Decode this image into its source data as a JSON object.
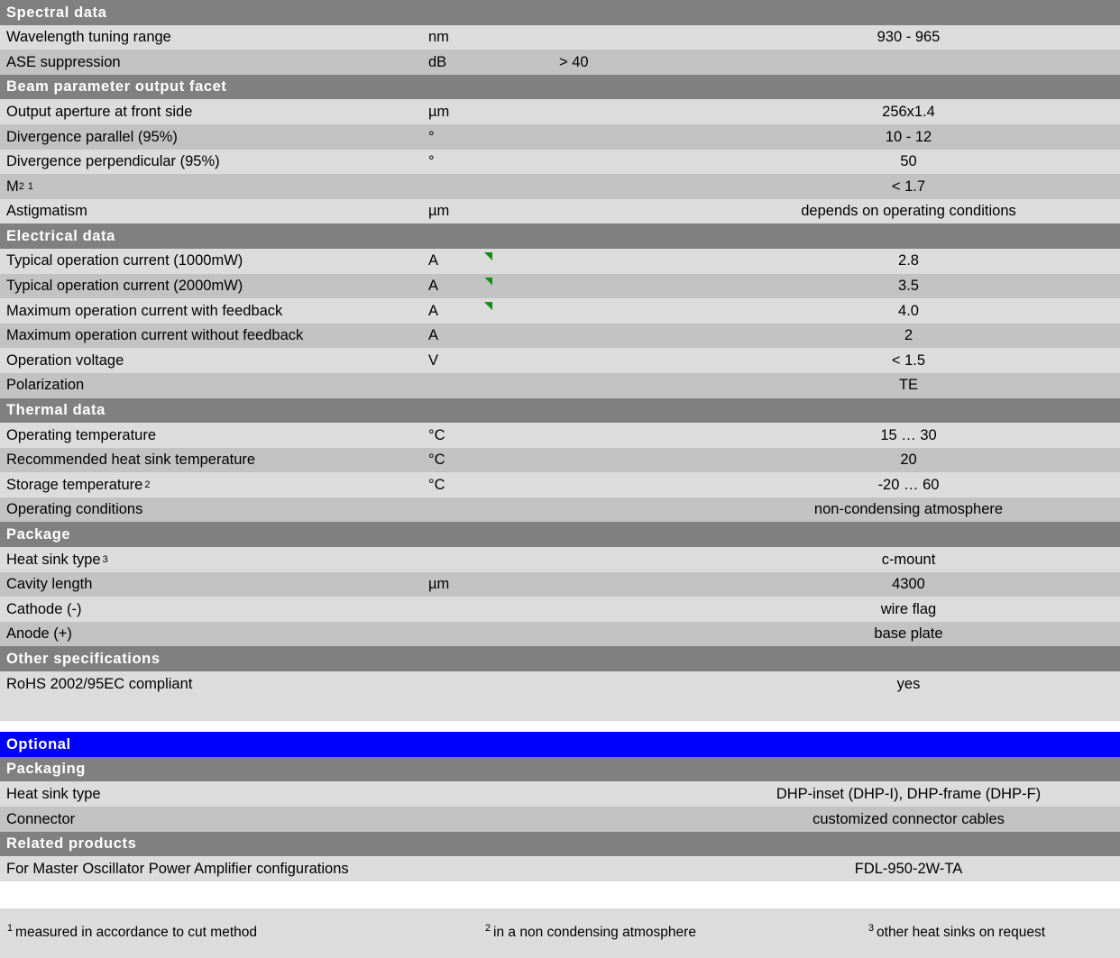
{
  "colors": {
    "section_header_bg": "#808080",
    "row_light_bg": "#dcdcdc",
    "row_dark_bg": "#c2c2c2",
    "optional_accent_bg": "#0000ff",
    "note_marker": "#128c12",
    "text": "#000000",
    "header_text": "#ffffff"
  },
  "sections": [
    {
      "title": "Spectral data",
      "rows": [
        {
          "label": "Wavelength tuning range",
          "unit": "nm",
          "extra": "",
          "value": "930 - 965",
          "marker": false
        },
        {
          "label": "ASE suppression",
          "unit": "dB",
          "extra": "> 40",
          "value": "",
          "marker": false
        }
      ]
    },
    {
      "title": "Beam parameter output facet",
      "rows": [
        {
          "label": "Output aperture at front side",
          "unit": "µm",
          "extra": "",
          "value": "256x1.4",
          "marker": false
        },
        {
          "label": "Divergence parallel (95%)",
          "unit": "°",
          "extra": "",
          "value": "10 - 12",
          "marker": false
        },
        {
          "label": "Divergence perpendicular (95%)",
          "unit": "°",
          "extra": "",
          "value": "50",
          "marker": false
        },
        {
          "label": "M2 1",
          "label_html": "M<sup class=\"exp\">2</sup><sup class=\"note\">1</sup>",
          "unit": "",
          "extra": "",
          "value": "< 1.7",
          "marker": false
        },
        {
          "label": "Astigmatism",
          "unit": "µm",
          "extra": "",
          "value": "depends on operating conditions",
          "marker": false
        }
      ]
    },
    {
      "title": "Electrical data",
      "rows": [
        {
          "label": "Typical operation current (1000mW)",
          "unit": "A",
          "extra": "",
          "value": "2.8",
          "marker": true
        },
        {
          "label": "Typical operation current (2000mW)",
          "unit": "A",
          "extra": "",
          "value": "3.5",
          "marker": true
        },
        {
          "label": "Maximum operation current with feedback",
          "unit": "A",
          "extra": "",
          "value": "4.0",
          "marker": true
        },
        {
          "label": "Maximum operation current without feedback",
          "unit": "A",
          "extra": "",
          "value": "2",
          "marker": false
        },
        {
          "label": "Operation voltage",
          "unit": "V",
          "extra": "",
          "value": "< 1.5",
          "marker": false
        },
        {
          "label": "Polarization",
          "unit": "",
          "extra": "",
          "value": "TE",
          "marker": false
        }
      ]
    },
    {
      "title": "Thermal data",
      "rows": [
        {
          "label": "Operating temperature",
          "unit": "°C",
          "extra": "",
          "value": "15 … 30",
          "marker": false
        },
        {
          "label": "Recommended heat sink temperature",
          "unit": "°C",
          "extra": "",
          "value": "20",
          "marker": false
        },
        {
          "label": "Storage temperature 2",
          "label_html": "Storage temperature <sup>2</sup>",
          "unit": "°C",
          "extra": "",
          "value": "-20 … 60",
          "marker": false
        },
        {
          "label": "Operating conditions",
          "unit": "",
          "extra": "",
          "value": "non-condensing atmosphere",
          "marker": false
        }
      ]
    },
    {
      "title": "Package",
      "rows": [
        {
          "label": "Heat sink type 3",
          "label_html": "Heat sink type <sup>3</sup>",
          "unit": "",
          "extra": "",
          "value": "c-mount",
          "marker": false
        },
        {
          "label": "Cavity length",
          "unit": "µm",
          "extra": "",
          "value": "4300",
          "marker": false
        },
        {
          "label": "Cathode (-)",
          "unit": "",
          "extra": "",
          "value": "wire flag",
          "marker": false
        },
        {
          "label": "Anode (+)",
          "unit": "",
          "extra": "",
          "value": "base plate",
          "marker": false
        }
      ]
    },
    {
      "title": "Other specifications",
      "rows": [
        {
          "label": "RoHS 2002/95EC compliant",
          "unit": "",
          "extra": "",
          "value": "yes",
          "marker": false
        }
      ]
    }
  ],
  "optional": {
    "title": "Optional",
    "sections": [
      {
        "title": "Packaging",
        "rows": [
          {
            "label": "Heat sink type",
            "unit": "",
            "extra": "",
            "value": "DHP-inset (DHP-I), DHP-frame (DHP-F)",
            "marker": false
          },
          {
            "label": "Connector",
            "unit": "",
            "extra": "",
            "value": "customized connector cables",
            "marker": false
          }
        ]
      },
      {
        "title": "Related products",
        "rows": [
          {
            "label": "For Master Oscillator Power Amplifier configurations",
            "unit": "",
            "extra": "",
            "value": "FDL-950-2W-TA",
            "marker": false
          }
        ]
      }
    ]
  },
  "footnotes": [
    {
      "marker": "1",
      "text": "measured in accordance to cut method"
    },
    {
      "marker": "2",
      "text": "in a non condensing atmosphere"
    },
    {
      "marker": "3",
      "text": "other heat sinks on request"
    }
  ]
}
